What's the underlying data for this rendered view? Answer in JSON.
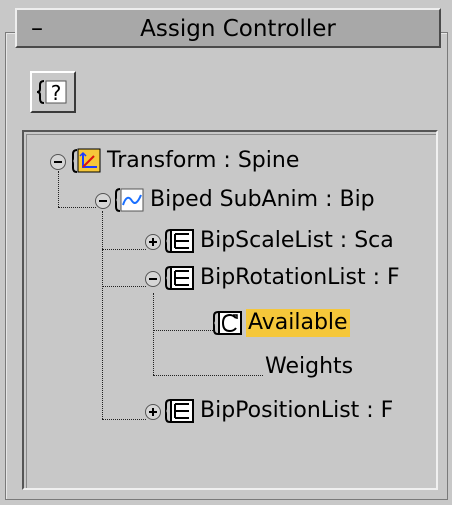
{
  "rollout": {
    "collapse_symbol": "–",
    "title": "Assign Controller"
  },
  "toolbar": {
    "help_button_icon": "help-icon",
    "help_glyph": "?"
  },
  "tree": {
    "nodes": [
      {
        "label": "Transform : Spine",
        "icon": "transform-controller-icon",
        "toggle": "minus"
      },
      {
        "label": "Biped SubAnim  : Bip",
        "icon": "curve-controller-icon",
        "toggle": "minus"
      },
      {
        "label": "BipScaleList : Sca",
        "icon": "list-controller-icon",
        "toggle": "plus"
      },
      {
        "label": "BipRotationList : F",
        "icon": "list-controller-icon",
        "toggle": "minus"
      },
      {
        "label": "Available",
        "icon": "available-controller-icon",
        "toggle": "none",
        "selected": true
      },
      {
        "label": "Weights",
        "icon": "none",
        "toggle": "none"
      },
      {
        "label": "BipPositionList : F",
        "icon": "list-controller-icon",
        "toggle": "plus"
      }
    ]
  },
  "colors": {
    "selection": "#f5c73a",
    "panel": "#c8c8c8",
    "title_bar": "#a8a8a8"
  }
}
